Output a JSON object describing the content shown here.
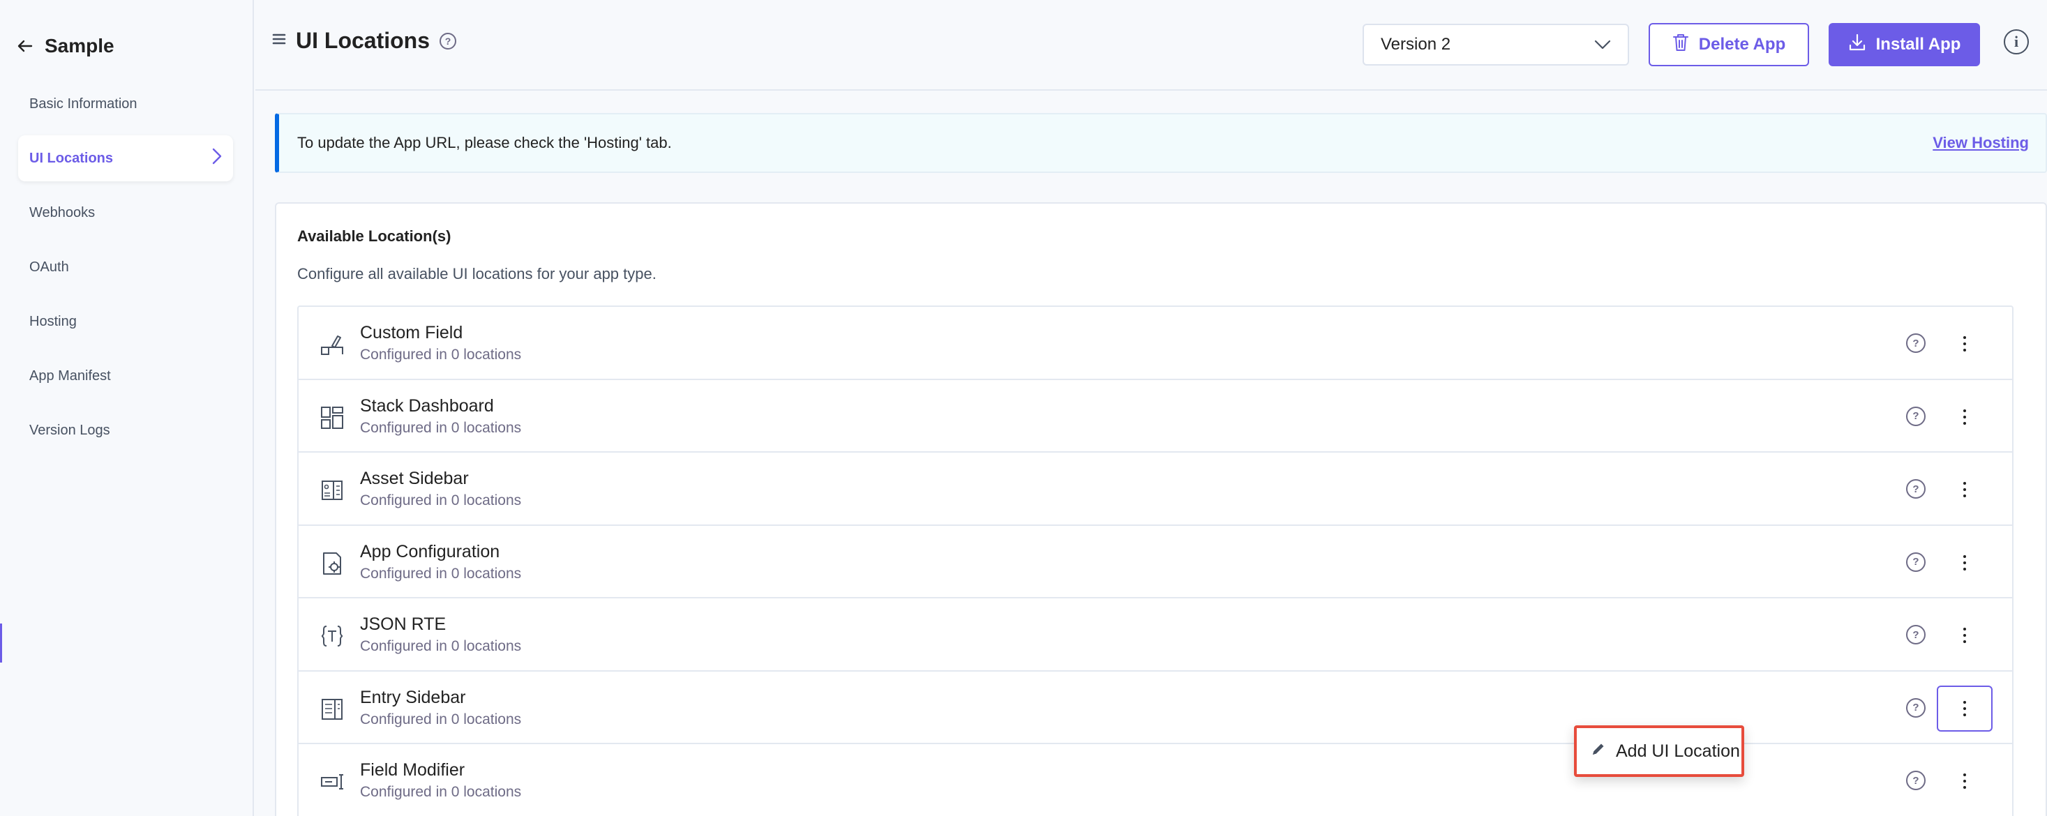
{
  "sidebar": {
    "app_name": "Sample",
    "items": [
      {
        "label": "Basic Information"
      },
      {
        "label": "UI Locations"
      },
      {
        "label": "Webhooks"
      },
      {
        "label": "OAuth"
      },
      {
        "label": "Hosting"
      },
      {
        "label": "App Manifest"
      },
      {
        "label": "Version Logs"
      }
    ]
  },
  "header": {
    "title": "UI Locations",
    "version_selected": "Version 2",
    "delete_label": "Delete App",
    "install_label": "Install App"
  },
  "notice": {
    "text": "To update the App URL, please check the 'Hosting' tab.",
    "link": "View Hosting"
  },
  "locations": {
    "title": "Available Location(s)",
    "description": "Configure all available UI locations for your app type.",
    "items": [
      {
        "name": "Custom Field",
        "status": "Configured in 0 locations",
        "icon": "custom-field-icon"
      },
      {
        "name": "Stack Dashboard",
        "status": "Configured in 0 locations",
        "icon": "dashboard-icon"
      },
      {
        "name": "Asset Sidebar",
        "status": "Configured in 0 locations",
        "icon": "asset-sidebar-icon"
      },
      {
        "name": "App Configuration",
        "status": "Configured in 0 locations",
        "icon": "app-config-icon"
      },
      {
        "name": "JSON RTE",
        "status": "Configured in 0 locations",
        "icon": "json-rte-icon"
      },
      {
        "name": "Entry Sidebar",
        "status": "Configured in 0 locations",
        "icon": "entry-sidebar-icon"
      },
      {
        "name": "Field Modifier",
        "status": "Configured in 0 locations",
        "icon": "field-modifier-icon"
      }
    ]
  },
  "dropdown": {
    "add_label": "Add UI Location"
  },
  "colors": {
    "accent": "#6c5ce7",
    "notice_border": "#0469e3",
    "highlight": "#e74c3c"
  }
}
